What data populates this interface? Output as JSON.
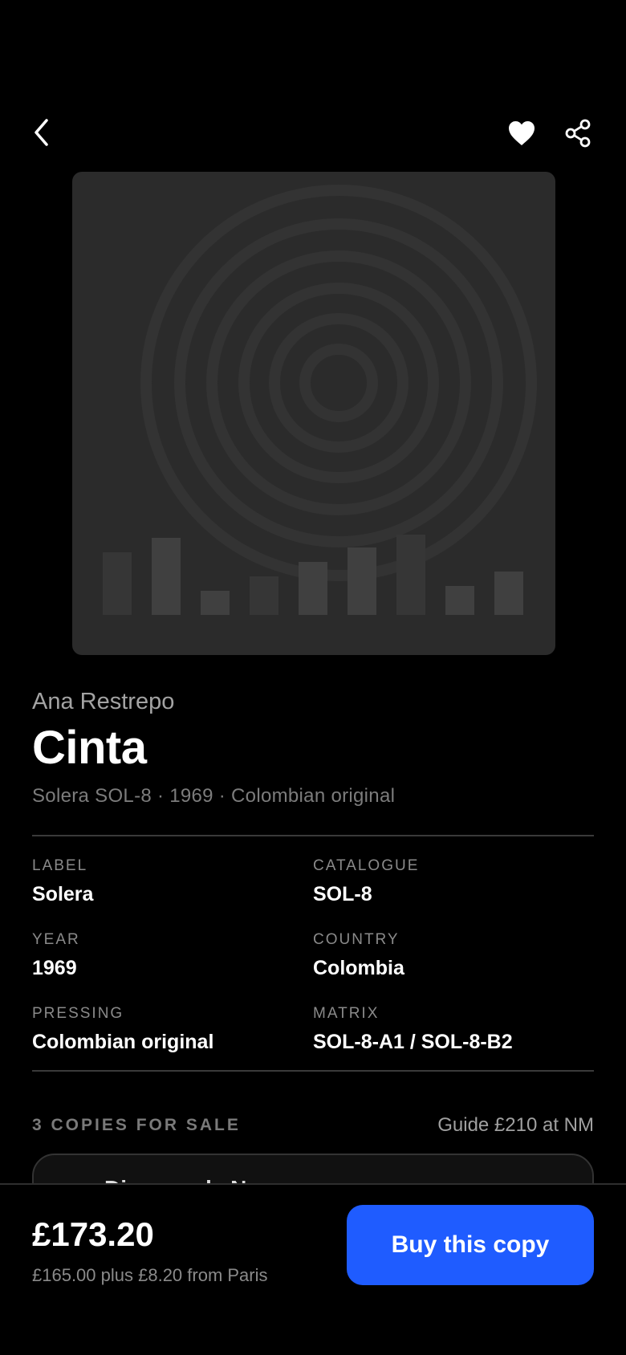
{
  "header": {
    "back_icon": "chevron-left-icon",
    "favorite_icon": "heart-icon",
    "share_icon": "share-icon"
  },
  "release": {
    "artist": "Ana Restrepo",
    "title": "Cinta",
    "subline": "Solera SOL-8 · 1969 · Colombian original"
  },
  "specs": {
    "label": {
      "label": "LABEL",
      "value": "Solera"
    },
    "catalogue": {
      "label": "CATALOGUE",
      "value": "SOL-8"
    },
    "year": {
      "label": "YEAR",
      "value": "1969"
    },
    "country": {
      "label": "COUNTRY",
      "value": "Colombia"
    },
    "pressing": {
      "label": "PRESSING",
      "value": "Colombian original"
    },
    "matrix": {
      "label": "MATRIX",
      "value": "SOL-8-A1 / SOL-8-B2"
    }
  },
  "sale": {
    "count_label": "3 COPIES FOR SALE",
    "guide": "Guide £210 at NM",
    "first_listing_seller": "Disques de Nuage"
  },
  "purchase": {
    "price": "£173.20",
    "price_detail": "£165.00 plus £8.20 from Paris",
    "buy_label": "Buy this copy"
  },
  "colors": {
    "background": "#000000",
    "accent": "#1f5cff",
    "cover": "#2b2b2b"
  }
}
